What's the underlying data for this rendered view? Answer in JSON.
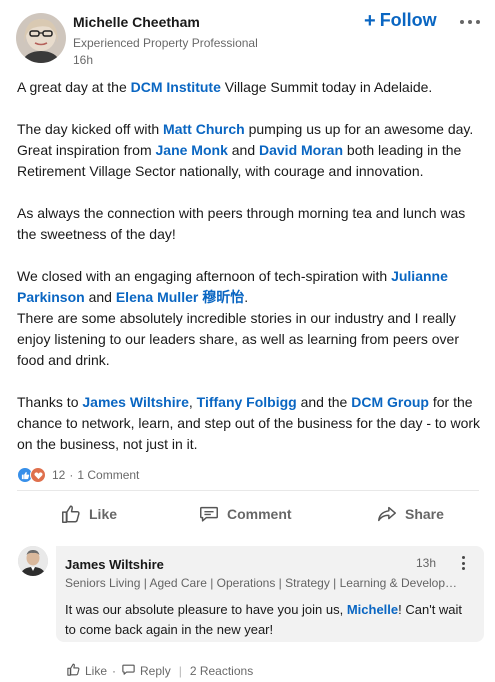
{
  "post": {
    "author": {
      "name": "Michelle Cheetham",
      "headline": "Experienced Property Professional",
      "time": "16h"
    },
    "follow_label": "Follow",
    "body": {
      "p1": {
        "t1": "A great day at the ",
        "m1": "DCM Institute",
        "t2": " Village Summit today in Adelaide."
      },
      "p2": {
        "t1": "The day kicked off with ",
        "m1": "Matt Church",
        "t2": " pumping us up for an awesome day. Great inspiration from ",
        "m2": "Jane Monk",
        "t3": " and ",
        "m3": "David Moran",
        "t4": " both leading in the Retirement Village Sector nationally, with courage and innovation."
      },
      "p3": {
        "t1": "As always the connection with peers through morning tea and lunch was the sweetness of the day!"
      },
      "p4": {
        "t1": "We closed with an engaging afternoon of tech-spiration with ",
        "m1": "Julianne Parkinson",
        "t2": " and ",
        "m2": "Elena Muller 穆昕怡",
        "t3": ".",
        "t4": "There are some absolutely incredible stories in our industry and I really enjoy listening to our leaders share, as well as learning from peers over food and drink."
      },
      "p5": {
        "t1": "Thanks to ",
        "m1": "James Wiltshire",
        "t2": ", ",
        "m2": "Tiffany Folbigg",
        "t3": " and the ",
        "m3": "DCM Group",
        "t4": " for the chance to network, learn, and step out of the business for the day - to work on the business, not just in it."
      }
    },
    "social": {
      "reactions": "12",
      "separator": "·",
      "comments": "1 Comment",
      "reaction_icons": [
        "like-icon",
        "love-icon"
      ]
    },
    "actions": {
      "like": "Like",
      "comment": "Comment",
      "share": "Share"
    }
  },
  "comment": {
    "author": "James Wiltshire",
    "time": "13h",
    "headline": "Seniors Living | Aged Care | Operations | Strategy | Learning & Development | Governance",
    "text": {
      "t1": "It was our absolute pleasure to have you join us, ",
      "m1": "Michelle",
      "t2": "! Can't wait to come back again in the new year!"
    },
    "actions": {
      "like": "Like",
      "dot": "·",
      "reply": "Reply",
      "bar": "|",
      "reactions": "2 Reactions"
    }
  },
  "colors": {
    "link": "#0a66c2",
    "text": "#191919",
    "muted": "#666666",
    "like_reaction": "#378fe9",
    "love_reaction": "#df704d",
    "comment_bg": "#f2f2f2"
  }
}
